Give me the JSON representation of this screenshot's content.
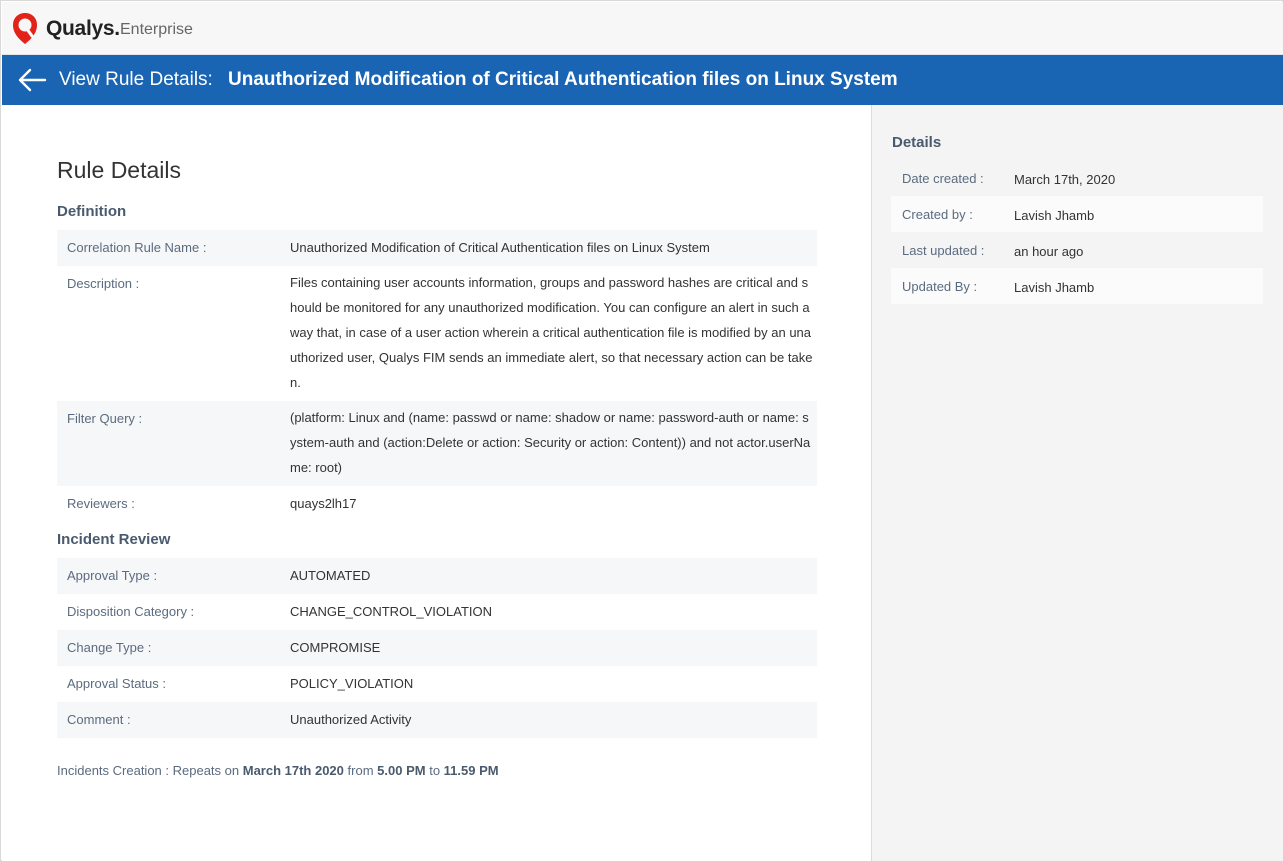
{
  "brand": {
    "name": "Qualys.",
    "product": "Enterprise"
  },
  "header": {
    "label": "View Rule Details:",
    "title": "Unauthorized Modification of Critical Authentication files on Linux System"
  },
  "page_title": "Rule Details",
  "definition": {
    "section_title": "Definition",
    "rows": [
      {
        "key": "Correlation Rule Name :",
        "value": "Unauthorized Modification of Critical Authentication files on Linux System"
      },
      {
        "key": "Description :",
        "value": "Files containing user accounts information, groups and password hashes are critical and should be monitored for any unauthorized modification. You can configure an alert in such a way that, in case of a user action wherein a critical authentication file is modified by an unauthorized user, Qualys FIM sends an immediate alert, so that necessary action can be taken."
      },
      {
        "key": "Filter Query :",
        "value": "(platform: Linux and (name: passwd or name: shadow or name: password-auth or name: system-auth and (action:Delete or action: Security or action: Content)) and not actor.userName: root)"
      },
      {
        "key": "Reviewers :",
        "value": "quays2lh17"
      }
    ]
  },
  "incident_review": {
    "section_title": "Incident Review",
    "rows": [
      {
        "key": "Approval Type :",
        "value": "AUTOMATED"
      },
      {
        "key": "Disposition Category :",
        "value": "CHANGE_CONTROL_VIOLATION"
      },
      {
        "key": "Change Type :",
        "value": "COMPROMISE"
      },
      {
        "key": "Approval Status :",
        "value": "POLICY_VIOLATION"
      },
      {
        "key": "Comment :",
        "value": "Unauthorized Activity"
      }
    ]
  },
  "incidents_creation": {
    "prefix": "Incidents Creation : Repeats on",
    "date": "March 17th 2020",
    "from_word": "from",
    "from_time": "5.00 PM",
    "to_word": "to",
    "to_time": "11.59 PM"
  },
  "details": {
    "title": "Details",
    "rows": [
      {
        "key": "Date created :",
        "value": "March 17th, 2020"
      },
      {
        "key": "Created by :",
        "value": "Lavish Jhamb"
      },
      {
        "key": "Last updated :",
        "value": "an hour ago"
      },
      {
        "key": "Updated By :",
        "value": "Lavish Jhamb"
      }
    ]
  },
  "colors": {
    "header_bg": "#1a64b4",
    "logo_red": "#e2231a",
    "label_text": "#5b6b7f"
  },
  "icons": {
    "back": "arrow-left-icon",
    "logo": "qualys-shield-icon"
  }
}
